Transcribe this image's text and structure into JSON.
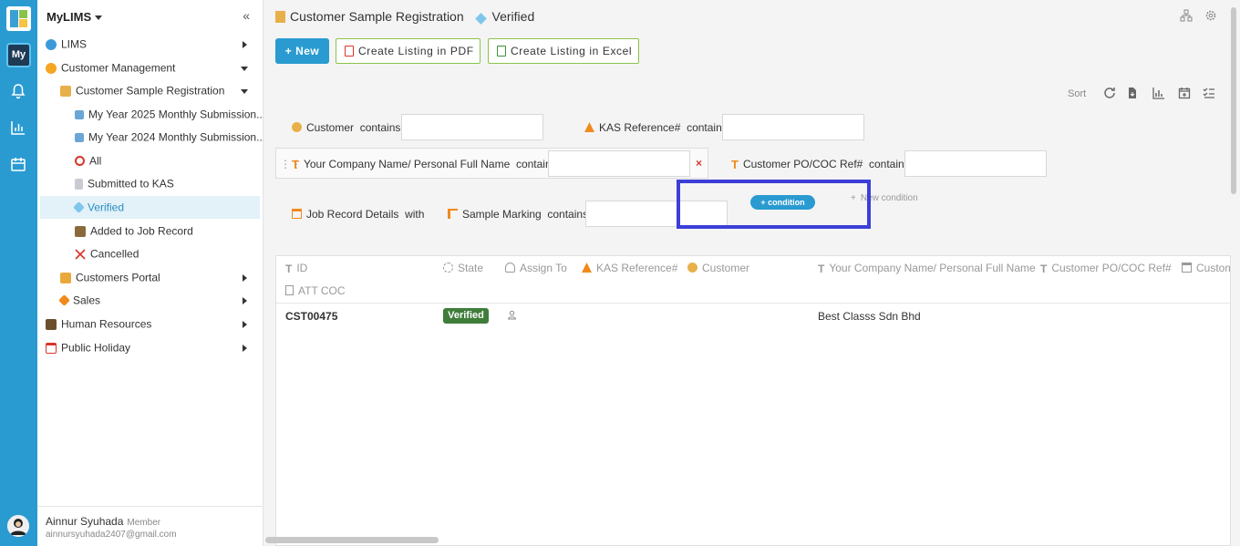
{
  "sidebar": {
    "app_name": "MyLIMS",
    "items": [
      {
        "label": "LIMS"
      },
      {
        "label": "Customer Management"
      },
      {
        "label": "Customer Sample Registration"
      },
      {
        "label": "My Year 2025 Monthly Submission..."
      },
      {
        "label": "My Year 2024 Monthly Submission..."
      },
      {
        "label": "All"
      },
      {
        "label": "Submitted to KAS"
      },
      {
        "label": "Verified"
      },
      {
        "label": "Added to Job Record"
      },
      {
        "label": "Cancelled"
      },
      {
        "label": "Customers Portal"
      },
      {
        "label": "Sales"
      },
      {
        "label": "Human Resources"
      },
      {
        "label": "Public Holiday"
      }
    ],
    "user": {
      "name": "Ainnur Syuhada",
      "role": "Member",
      "email": "ainnursyuhada2407@gmail.com"
    }
  },
  "rail": {
    "my_label": "My"
  },
  "header": {
    "title": "Customer Sample Registration",
    "view": "Verified"
  },
  "toolbar": {
    "new_label": "New",
    "pdf_label": "Create Listing in PDF",
    "excel_label": "Create Listing in Excel",
    "sort_label": "Sort"
  },
  "filters": {
    "customer": {
      "field": "Customer",
      "op": "contains"
    },
    "kas_ref": {
      "field": "KAS Reference#",
      "op": "contains"
    },
    "company": {
      "field": "Your Company Name/ Personal Full Name",
      "op": "contains"
    },
    "po_ref": {
      "field": "Customer PO/COC Ref#",
      "op": "contains"
    },
    "job_record": {
      "field": "Job Record Details",
      "op": "with"
    },
    "sample_marking": {
      "field": "Sample Marking",
      "op": "contains"
    },
    "add_condition": "condition",
    "new_condition": "New condition",
    "remove_icon": "×"
  },
  "table": {
    "columns": [
      "ID",
      "State",
      "Assign To",
      "KAS Reference#",
      "Customer",
      "Your Company Name/ Personal Full Name",
      "Customer PO/COC Ref#",
      "Custom",
      "ATT COC"
    ],
    "rows": [
      {
        "id": "CST00475",
        "state": "Verified",
        "company": "Best Classs Sdn Bhd"
      }
    ]
  },
  "colors": {
    "primary": "#2a9bd1",
    "excel_border": "#8bc34a",
    "verified_badge": "#3f7d3a",
    "highlight": "#3b3fd8"
  }
}
